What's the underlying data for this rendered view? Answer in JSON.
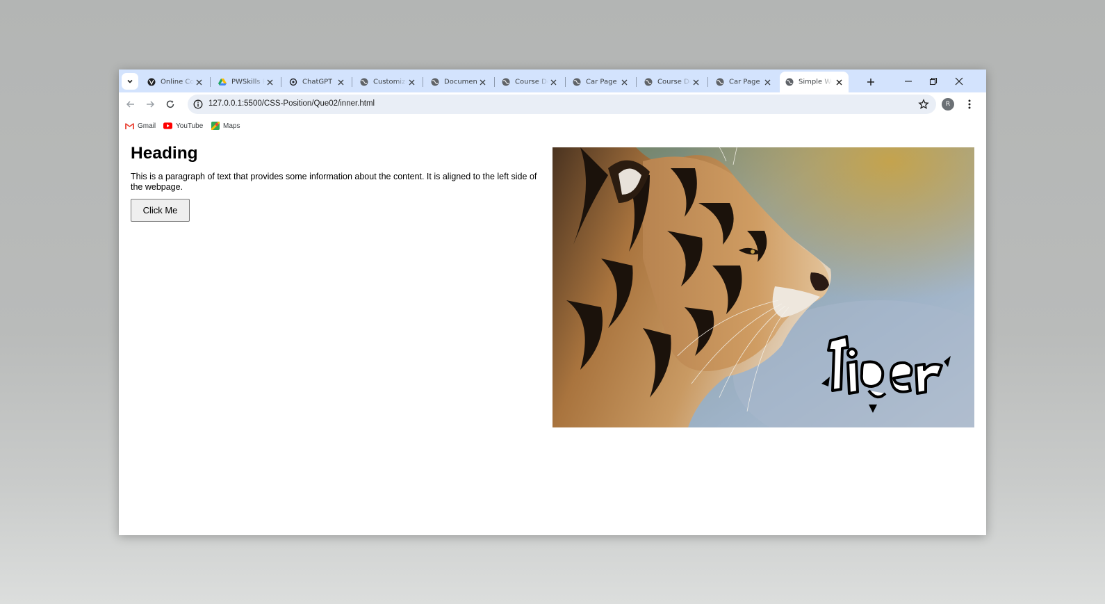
{
  "browser": {
    "tabs": [
      {
        "title": "Online Co",
        "icon": "globe-icon",
        "active": false
      },
      {
        "title": "PWSkills Pr",
        "icon": "google-drive-icon",
        "active": false
      },
      {
        "title": "ChatGPT",
        "icon": "chatgpt-icon",
        "active": false
      },
      {
        "title": "Customize",
        "icon": "globe-icon",
        "active": false
      },
      {
        "title": "Document",
        "icon": "globe-icon",
        "active": false
      },
      {
        "title": "Course De",
        "icon": "globe-icon",
        "active": false
      },
      {
        "title": "Car Page",
        "icon": "globe-icon",
        "active": false
      },
      {
        "title": "Course De",
        "icon": "globe-icon",
        "active": false
      },
      {
        "title": "Car Page",
        "icon": "globe-icon",
        "active": false
      },
      {
        "title": "Simple We",
        "icon": "globe-icon",
        "active": true
      }
    ],
    "url": "127.0.0.1:5500/CSS-Position/Que02/inner.html",
    "profile_initial": "R",
    "bookmarks": [
      {
        "label": "Gmail",
        "icon": "gmail-icon"
      },
      {
        "label": "YouTube",
        "icon": "youtube-icon"
      },
      {
        "label": "Maps",
        "icon": "maps-icon"
      }
    ]
  },
  "page": {
    "heading": "Heading",
    "paragraph": "This is a paragraph of text that provides some information about the content. It is aligned to the left side of the webpage.",
    "button_label": "Click Me",
    "image_caption": "Tiger"
  },
  "colors": {
    "tabstrip": "#d3e3fd",
    "omnibox": "#e9eef6",
    "button_bg": "#efefef"
  }
}
